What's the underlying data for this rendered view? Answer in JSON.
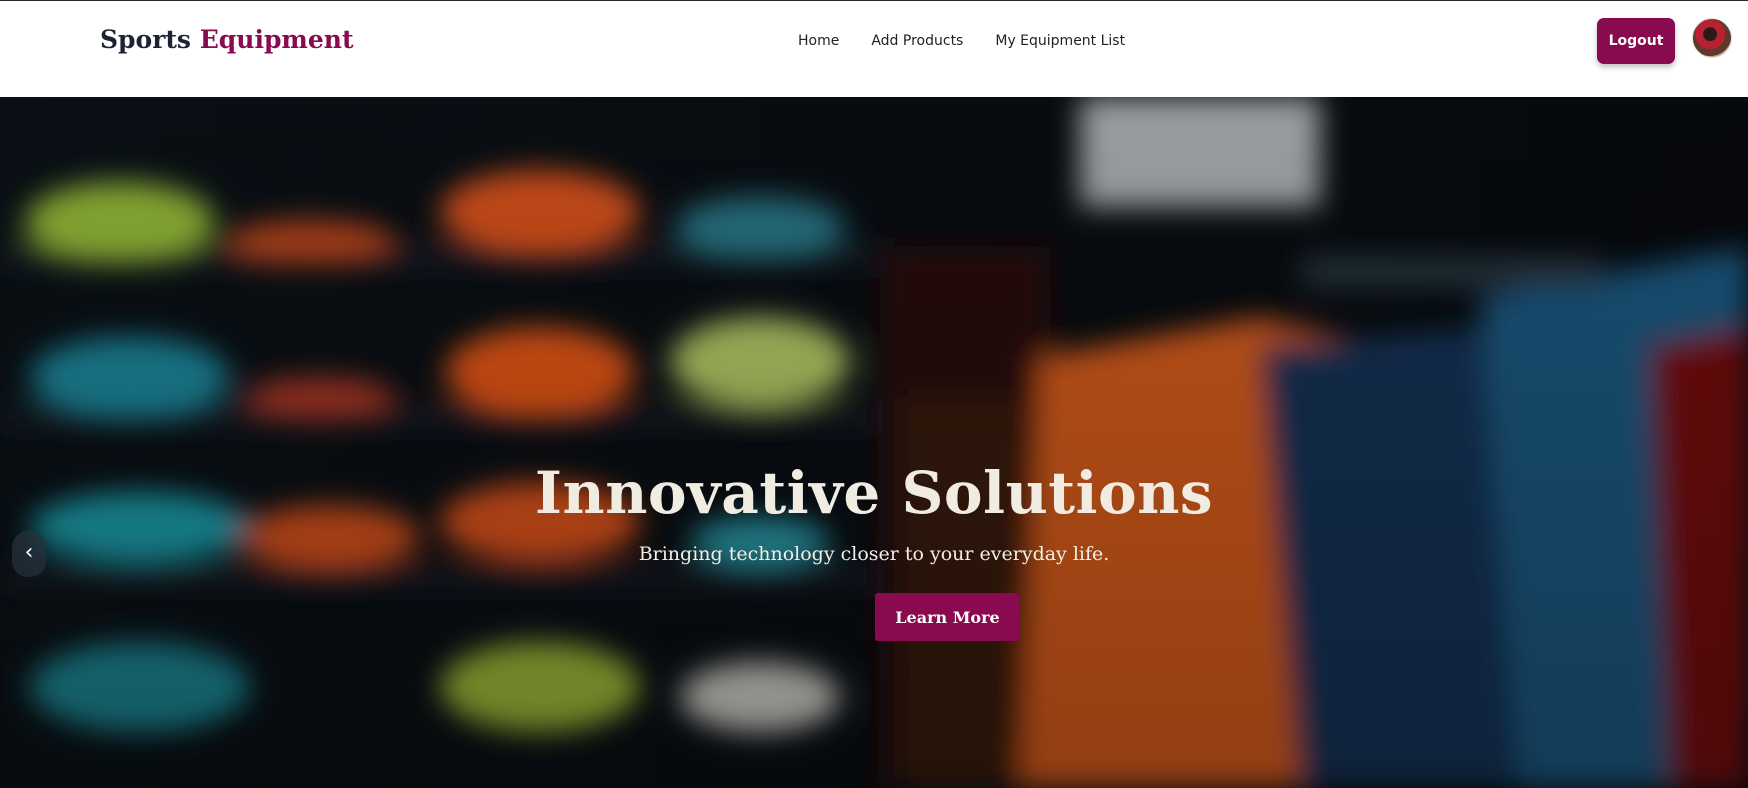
{
  "navbar": {
    "brand_part1": "Sports",
    "brand_part2": "Equipment",
    "links": [
      "Home",
      "Add Products",
      "My Equipment List"
    ],
    "logout_label": "Logout"
  },
  "hero": {
    "title": "Innovative Solutions",
    "subtitle": "Bringing technology closer to your everyday life.",
    "cta_label": "Learn More",
    "prev_icon": "‹"
  },
  "colors": {
    "accent": "#8a0a4f",
    "brand_dark": "#1c2333"
  },
  "icons": {
    "avatar": "user-avatar",
    "carousel_prev": "chevron-left-icon"
  }
}
